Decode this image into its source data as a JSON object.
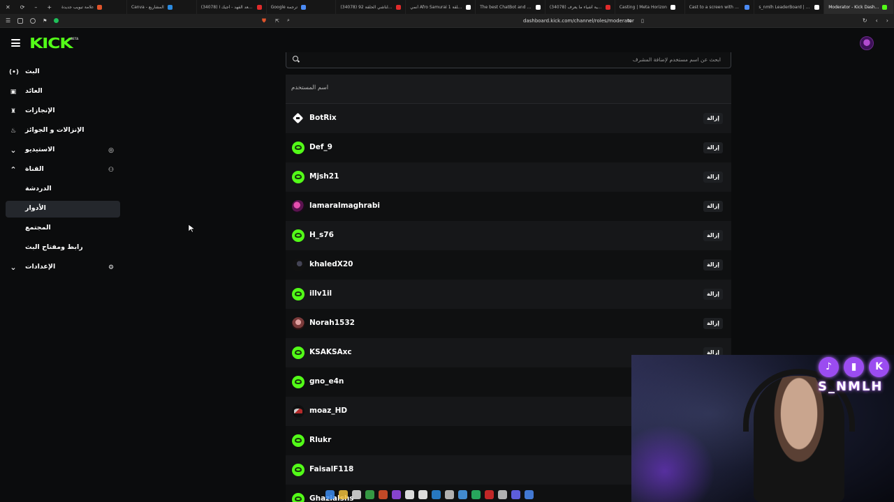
{
  "browser": {
    "tabs": [
      {
        "label": "علامة تبويب جديدة",
        "color": "#e0542b"
      },
      {
        "label": "Canva - المشاريع",
        "color": "#2b8be0"
      },
      {
        "label": "(34078) سعد الفهد - أجيك ا...",
        "color": "#e02b2b"
      },
      {
        "label": "Google ترجمة",
        "color": "#4b8bf5"
      },
      {
        "label": "(34078) الناشي الحلقة 92 ...",
        "color": "#e02b2b"
      },
      {
        "label": "أنمي Afro Samurai الحلقة 1",
        "color": "#ffffff"
      },
      {
        "label": "The best ChatBot and Widg...",
        "color": "#ffffff"
      },
      {
        "label": "(34078) ثمانية أشياء ما يعرف...",
        "color": "#e02b2b"
      },
      {
        "label": "Casting | Meta Horizon",
        "color": "#ffffff"
      },
      {
        "label": "Cast to a screen with Meta...",
        "color": "#4b8bf5"
      },
      {
        "label": "s_nmlh LeaderBoard | The ...",
        "color": "#ffffff"
      },
      {
        "label": "Moderator - Kick Dash...",
        "color": "#53fc18"
      }
    ],
    "url": "dashboard.kick.com/channel/roles/moderator"
  },
  "header": {
    "logo": "KICK",
    "beta": "BETA"
  },
  "sidebar": {
    "items": [
      {
        "label": "البث",
        "icon": "broadcast-icon",
        "glyph": "(•)"
      },
      {
        "label": "العائد",
        "icon": "revenue-icon",
        "glyph": "▣"
      },
      {
        "label": "الإنجازات",
        "icon": "trophy-icon",
        "glyph": "♜"
      },
      {
        "label": "الإنزالات و الجوائز",
        "icon": "drops-icon",
        "glyph": "♨"
      },
      {
        "label": "الاستيديو",
        "icon": "chevron-down-icon",
        "glyph": "⌄",
        "right_icon": "studio-camera-icon",
        "right_glyph": "◎"
      },
      {
        "label": "القناة",
        "icon": "chevron-up-icon",
        "glyph": "⌃",
        "right_icon": "channel-users-icon",
        "right_glyph": "⚇"
      },
      {
        "label": "الدردشة",
        "sub": true
      },
      {
        "label": "الأدوار",
        "sub": true,
        "active": true
      },
      {
        "label": "المجتمع",
        "sub": true
      },
      {
        "label": "رابط ومفتاح البث",
        "sub": true
      },
      {
        "label": "الإعدادات",
        "icon": "chevron-down-icon",
        "glyph": "⌄",
        "right_icon": "gear-icon",
        "right_glyph": "⚙"
      }
    ]
  },
  "main": {
    "search_placeholder": "ابحث عن اسم مستخدم لإضافة المشرف",
    "column_header": "اسم المستخدم",
    "remove_label": "إزالة",
    "moderators": [
      {
        "name": "BotRix",
        "avatar": "bot",
        "remove": true
      },
      {
        "name": "Def_9",
        "avatar": "kick",
        "remove": true
      },
      {
        "name": "Mjsh21",
        "avatar": "kick",
        "remove": true
      },
      {
        "name": "lamaralmaghrabi",
        "avatar": "pink",
        "remove": true
      },
      {
        "name": "H_s76",
        "avatar": "kick",
        "remove": true
      },
      {
        "name": "khaledX20",
        "avatar": "dark",
        "remove": true
      },
      {
        "name": "illv1il",
        "avatar": "kick",
        "remove": true
      },
      {
        "name": "Norah1532",
        "avatar": "face",
        "remove": true
      },
      {
        "name": "KSAKSAxc",
        "avatar": "kick",
        "remove": true
      },
      {
        "name": "gno_e4n",
        "avatar": "kick",
        "remove": false
      },
      {
        "name": "moaz_HD",
        "avatar": "red",
        "remove": false
      },
      {
        "name": "Rlukr",
        "avatar": "kick",
        "remove": false
      },
      {
        "name": "FaisalF118",
        "avatar": "kick",
        "remove": false
      },
      {
        "name": "Ghazialshs",
        "avatar": "kick",
        "remove": false
      }
    ]
  },
  "webcam": {
    "streamer_name": "S_NMLH",
    "socials": [
      {
        "icon": "tiktok-icon",
        "glyph": "♪"
      },
      {
        "icon": "twitch-icon",
        "glyph": "▮"
      },
      {
        "icon": "kick-icon",
        "glyph": "K"
      }
    ]
  }
}
